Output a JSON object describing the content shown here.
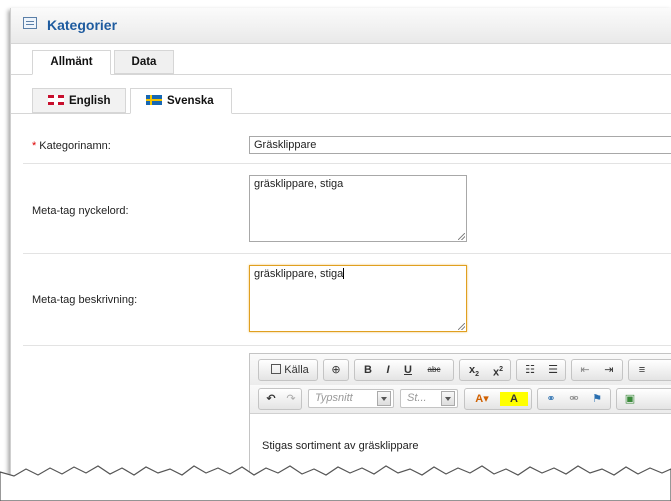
{
  "window": {
    "title": "Kategorier"
  },
  "main_tabs": [
    {
      "label": "Allmänt",
      "active": true
    },
    {
      "label": "Data",
      "active": false
    }
  ],
  "language_tabs": [
    {
      "label": "English",
      "flag": "uk-flag",
      "active": false
    },
    {
      "label": "Svenska",
      "flag": "se-flag",
      "active": true
    }
  ],
  "form": {
    "category_name": {
      "label": "Kategorinamn:",
      "required_mark": "*",
      "value": "Gräsklippare"
    },
    "meta_keywords": {
      "label": "Meta-tag nyckelord:",
      "value": "gräsklippare, stiga"
    },
    "meta_description": {
      "label": "Meta-tag beskrivning:",
      "value": "gräsklippare, stiga"
    }
  },
  "editor": {
    "source_label": "Källa",
    "font_placeholder": "Typsnitt",
    "size_placeholder": "St...",
    "content": "Stigas sortiment av gräsklippare"
  },
  "colors": {
    "title": "#1e5b9f",
    "required": "#dd0000",
    "focus_border": "#e0a020"
  }
}
